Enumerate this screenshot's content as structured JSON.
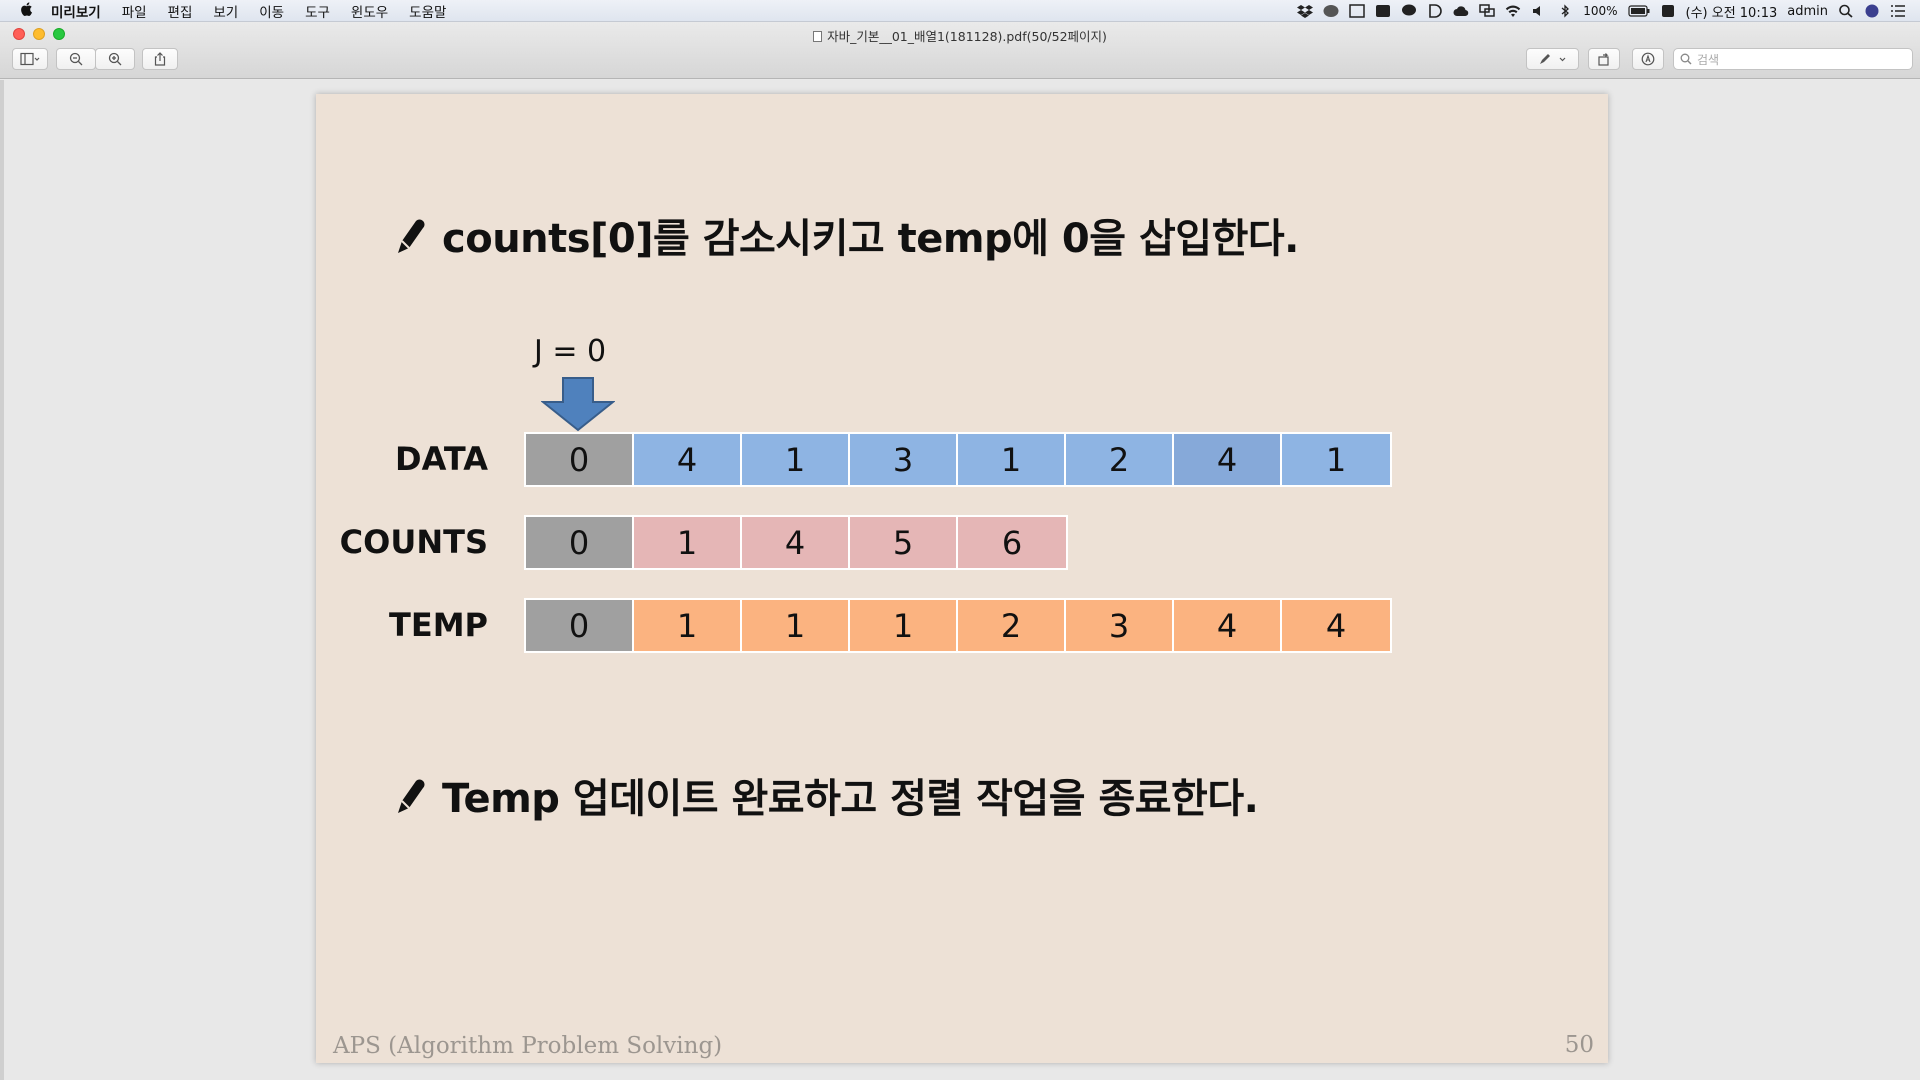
{
  "menubar": {
    "app_name": "미리보기",
    "items": [
      "파일",
      "편집",
      "보기",
      "이동",
      "도구",
      "윈도우",
      "도움말"
    ],
    "battery": "100%",
    "clock": "(수) 오전 10:13",
    "user": "admin"
  },
  "window": {
    "title": "자바_기본__01_배열1(181128).pdf(50/52페이지)",
    "search_placeholder": "검색"
  },
  "slide": {
    "bullet1": "counts[0]를 감소시키고 temp에 0을 삽입한다.",
    "bullet2": "Temp 업데이트 완료하고 정렬 작업을 종료한다.",
    "j_label": "J = 0",
    "rows": {
      "data": {
        "label": "DATA",
        "values": [
          "0",
          "4",
          "1",
          "3",
          "1",
          "2",
          "4",
          "1"
        ]
      },
      "counts": {
        "label": "COUNTS",
        "values": [
          "0",
          "1",
          "4",
          "5",
          "6"
        ]
      },
      "temp": {
        "label": "TEMP",
        "values": [
          "0",
          "1",
          "1",
          "1",
          "2",
          "3",
          "4",
          "4"
        ]
      }
    },
    "colors": {
      "highlight_gray": "#a0a0a0",
      "data_blue": "#8eb4e3",
      "counts_pink": "#e5b6b6",
      "temp_orange": "#fbb380",
      "arrow_blue": "#4f81bd"
    },
    "footer_left": "APS (Algorithm Problem Solving)",
    "page_number": "50"
  }
}
